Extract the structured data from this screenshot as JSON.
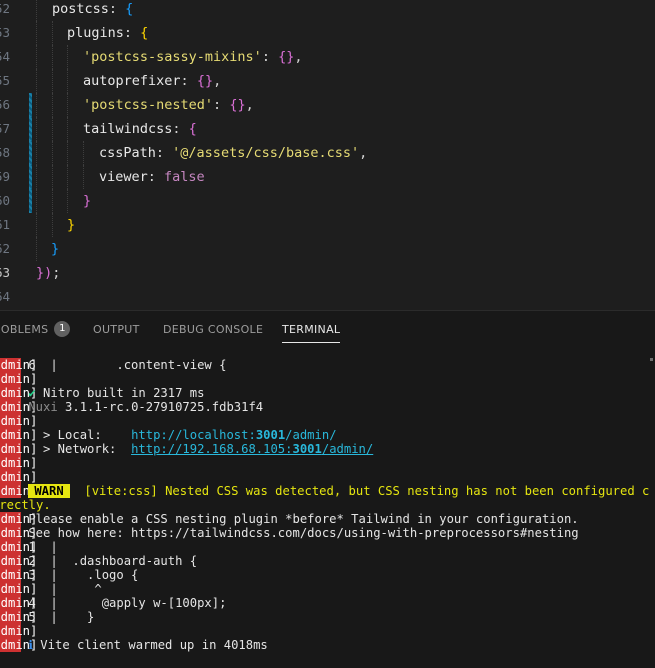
{
  "editor": {
    "lines": [
      {
        "num": "52",
        "tokens": [
          {
            "t": "postcss",
            "c": "k"
          },
          {
            "t": ": ",
            "c": "p"
          },
          {
            "t": "{",
            "c": "b3"
          }
        ]
      },
      {
        "num": "53",
        "tokens": [
          {
            "t": "plugins",
            "c": "k"
          },
          {
            "t": ": ",
            "c": "p"
          },
          {
            "t": "{",
            "c": "b1"
          }
        ]
      },
      {
        "num": "54",
        "tokens": [
          {
            "t": "'postcss-sassy-mixins'",
            "c": "s"
          },
          {
            "t": ": ",
            "c": "p"
          },
          {
            "t": "{}",
            "c": "b2"
          },
          {
            "t": ",",
            "c": "p"
          }
        ]
      },
      {
        "num": "55",
        "tokens": [
          {
            "t": "autoprefixer",
            "c": "k"
          },
          {
            "t": ": ",
            "c": "p"
          },
          {
            "t": "{}",
            "c": "b2"
          },
          {
            "t": ",",
            "c": "p"
          }
        ]
      },
      {
        "num": "56",
        "tokens": [
          {
            "t": "'postcss-nested'",
            "c": "s"
          },
          {
            "t": ": ",
            "c": "p"
          },
          {
            "t": "{}",
            "c": "b2"
          },
          {
            "t": ",",
            "c": "p"
          }
        ]
      },
      {
        "num": "57",
        "tokens": [
          {
            "t": "tailwindcss",
            "c": "k"
          },
          {
            "t": ": ",
            "c": "p"
          },
          {
            "t": "{",
            "c": "b2"
          }
        ]
      },
      {
        "num": "58",
        "tokens": [
          {
            "t": "cssPath",
            "c": "k"
          },
          {
            "t": ": ",
            "c": "p"
          },
          {
            "t": "'@/assets/css/base.css'",
            "c": "s"
          },
          {
            "t": ",",
            "c": "p"
          }
        ]
      },
      {
        "num": "59",
        "tokens": [
          {
            "t": "viewer",
            "c": "k"
          },
          {
            "t": ": ",
            "c": "p"
          },
          {
            "t": "false",
            "c": "kw"
          }
        ]
      },
      {
        "num": "60",
        "tokens": [
          {
            "t": "}",
            "c": "b2"
          }
        ]
      },
      {
        "num": "61",
        "tokens": [
          {
            "t": "}",
            "c": "b1"
          }
        ]
      },
      {
        "num": "62",
        "tokens": [
          {
            "t": "}",
            "c": "b3"
          }
        ]
      },
      {
        "num": "63",
        "tokens": [
          {
            "t": "})",
            "c": "b2"
          },
          {
            "t": ";",
            "c": "p"
          }
        ]
      },
      {
        "num": "64",
        "tokens": []
      }
    ]
  },
  "panel": {
    "tabs": [
      {
        "label": "PROBLEMS",
        "badge": "1"
      },
      {
        "label": "OUTPUT"
      },
      {
        "label": "DEBUG CONSOLE"
      },
      {
        "label": "TERMINAL",
        "active": true
      }
    ]
  },
  "terminal": {
    "tag": "[admin]",
    "lines": [
      {
        "tag": true,
        "segs": [
          {
            "t": " 6  |        .content-view {",
            "c": "tc"
          }
        ]
      },
      {
        "tag": true,
        "segs": []
      },
      {
        "tag": true,
        "segs": [
          {
            "t": " ✔",
            "c": "ok"
          },
          {
            "t": " Nitro built in 2317 ms",
            "c": "tc"
          }
        ]
      },
      {
        "tag": true,
        "segs": [
          {
            "t": " Nuxi ",
            "c": "gray"
          },
          {
            "t": "3.1.1-rc.0-27910725.fdb31f4",
            "c": "tc"
          }
        ]
      },
      {
        "tag": true,
        "segs": []
      },
      {
        "tag": true,
        "segs": [
          {
            "t": "   > Local:    ",
            "c": "tc"
          },
          {
            "t": "http://localhost:",
            "c": "cyan"
          },
          {
            "t": "3001",
            "c": "cyanb"
          },
          {
            "t": "/admin/",
            "c": "cyan"
          }
        ]
      },
      {
        "tag": true,
        "segs": [
          {
            "t": "   > Network:  ",
            "c": "tc"
          },
          {
            "t": "http://192.168.68.105:",
            "c": "cyan ul"
          },
          {
            "t": "3001",
            "c": "cyanb ul"
          },
          {
            "t": "/admin/",
            "c": "cyan ul"
          }
        ]
      },
      {
        "tag": true,
        "segs": []
      },
      {
        "tag": true,
        "segs": []
      },
      {
        "tag": true,
        "segs": [
          {
            "t": " ",
            "c": "tc"
          },
          {
            "t": "WARN",
            "c": "warnbadge"
          },
          {
            "t": "  [vite:css] Nested CSS was detected, but CSS nesting has not been configured c",
            "c": "yellow"
          }
        ]
      },
      {
        "tag": false,
        "segs": [
          {
            "t": "rrectly.",
            "c": "yellow"
          }
        ]
      },
      {
        "tag": true,
        "segs": [
          {
            "t": " Please enable a CSS nesting plugin *before* Tailwind in your configuration.",
            "c": "tc"
          }
        ]
      },
      {
        "tag": true,
        "segs": [
          {
            "t": " See how here: https://tailwindcss.com/docs/using-with-preprocessors#nesting",
            "c": "tc"
          }
        ]
      },
      {
        "tag": true,
        "segs": [
          {
            "t": " 1  |",
            "c": "tc"
          }
        ]
      },
      {
        "tag": true,
        "segs": [
          {
            "t": " 2  |  .dashboard-auth {",
            "c": "tc"
          }
        ]
      },
      {
        "tag": true,
        "segs": [
          {
            "t": " 3  |    .logo {",
            "c": "tc"
          }
        ]
      },
      {
        "tag": true,
        "segs": [
          {
            "t": "    |     ^",
            "c": "tc"
          }
        ]
      },
      {
        "tag": true,
        "segs": [
          {
            "t": " 4  |      @apply w-[100px];",
            "c": "tc"
          }
        ]
      },
      {
        "tag": true,
        "segs": [
          {
            "t": " 5  |    }",
            "c": "tc"
          }
        ]
      },
      {
        "tag": true,
        "segs": []
      },
      {
        "tag": true,
        "segs": [
          {
            "t": " ℹ",
            "c": "info"
          },
          {
            "t": " Vite client warmed up in 4018ms",
            "c": "tc"
          }
        ]
      }
    ]
  }
}
